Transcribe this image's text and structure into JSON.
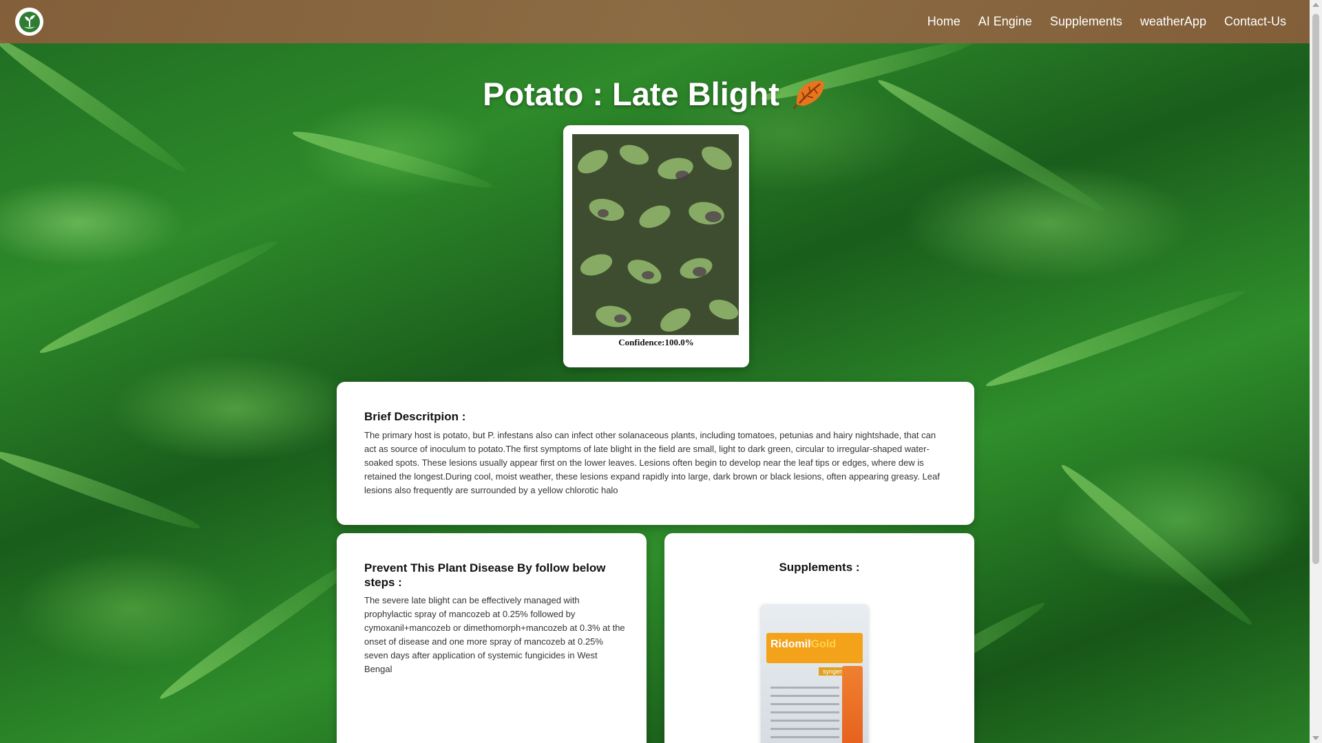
{
  "nav": {
    "links": [
      "Home",
      "AI Engine",
      "Supplements",
      "weatherApp",
      "Contact-Us"
    ]
  },
  "page": {
    "title": "Potato : Late Blight"
  },
  "result": {
    "confidence_text": "Confidence:100.0%"
  },
  "description": {
    "heading": "Brief Descritpion :",
    "body": "The primary host is potato, but P. infestans also can infect other solanaceous plants, including tomatoes, petunias and hairy nightshade, that can act as source of inoculum to potato.The first symptoms of late blight in the field are small, light to dark green, circular to irregular-shaped water-soaked spots. These lesions usually appear first on the lower leaves. Lesions often begin to develop near the leaf tips or edges, where dew is retained the longest.During cool, moist weather, these lesions expand rapidly into large, dark brown or black lesions, often appearing greasy. Leaf lesions also frequently are surrounded by a yellow chlorotic halo"
  },
  "prevention": {
    "heading": "Prevent This Plant Disease By follow below steps :",
    "body": "The severe late blight can be effectively managed with prophylactic spray of mancozeb at 0.25% followed by cymoxanil+mancozeb or dimethomorph+mancozeb at 0.3% at the onset of disease and one more spray of mancozeb at 0.25% seven days after application of systemic fungicides in West Bengal"
  },
  "supplements": {
    "heading": "Supplements :",
    "product_brand": "Ridomil",
    "product_brand_accent": "Gold",
    "product_maker": "syngenta"
  },
  "icons": {
    "logo": "sprout-logo-icon",
    "title_emoji": "falling-leaf-icon"
  },
  "colors": {
    "navbar": "#8b5e3c",
    "card": "#ffffff",
    "title": "#ffffff"
  }
}
